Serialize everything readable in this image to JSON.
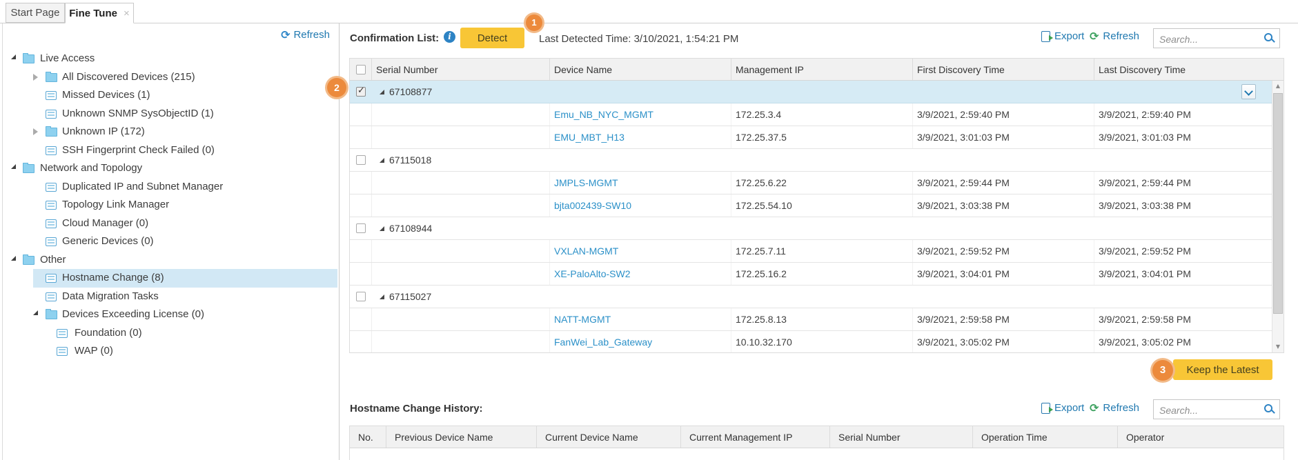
{
  "tabs": [
    {
      "label": "Start Page",
      "active": false
    },
    {
      "label": "Fine Tune",
      "active": true,
      "closable": true
    }
  ],
  "icons": {
    "close": "×",
    "refresh": "⟳",
    "scroll_up": "▲",
    "scroll_down": "▼",
    "info": "i",
    "check": "✓"
  },
  "left_panel": {
    "refresh_label": "Refresh",
    "tree": [
      {
        "label": "Live Access",
        "type": "folder",
        "level": 0,
        "expander": "expanded"
      },
      {
        "label": "All Discovered Devices (215)",
        "type": "folder",
        "level": 1,
        "expander": "collapsed"
      },
      {
        "label": "Missed Devices (1)",
        "type": "list",
        "level": 1,
        "expander": "none"
      },
      {
        "label": "Unknown SNMP SysObjectID (1)",
        "type": "list",
        "level": 1,
        "expander": "none"
      },
      {
        "label": "Unknown IP (172)",
        "type": "folder",
        "level": 1,
        "expander": "collapsed"
      },
      {
        "label": "SSH Fingerprint Check Failed (0)",
        "type": "list",
        "level": 1,
        "expander": "none"
      },
      {
        "label": "Network and Topology",
        "type": "folder",
        "level": 0,
        "expander": "expanded"
      },
      {
        "label": "Duplicated IP and Subnet Manager",
        "type": "list",
        "level": 1,
        "expander": "none"
      },
      {
        "label": "Topology Link Manager",
        "type": "list",
        "level": 1,
        "expander": "none"
      },
      {
        "label": "Cloud Manager (0)",
        "type": "list",
        "level": 1,
        "expander": "none"
      },
      {
        "label": "Generic Devices (0)",
        "type": "list",
        "level": 1,
        "expander": "none"
      },
      {
        "label": "Other",
        "type": "folder",
        "level": 0,
        "expander": "expanded"
      },
      {
        "label": "Hostname Change (8)",
        "type": "list",
        "level": 1,
        "expander": "none",
        "selected": true
      },
      {
        "label": "Data Migration Tasks",
        "type": "list",
        "level": 1,
        "expander": "none"
      },
      {
        "label": "Devices Exceeding License (0)",
        "type": "folder",
        "level": 1,
        "expander": "expanded"
      },
      {
        "label": "Foundation (0)",
        "type": "list",
        "level": 2,
        "expander": "none"
      },
      {
        "label": "WAP (0)",
        "type": "list",
        "level": 2,
        "expander": "none"
      }
    ]
  },
  "confirmation": {
    "title": "Confirmation List:",
    "detect_label": "Detect",
    "last_detected": "Last Detected Time: 3/10/2021, 1:54:21 PM",
    "export_label": "Export",
    "refresh_label": "Refresh",
    "search_placeholder": "Search...",
    "columns": [
      "Serial Number",
      "Device Name",
      "Management IP",
      "First Discovery Time",
      "Last Discovery Time"
    ],
    "groups": [
      {
        "serial": "67108877",
        "checked": true,
        "selected": true,
        "devices": [
          {
            "name": "Emu_NB_NYC_MGMT",
            "ip": "172.25.3.4",
            "first": "3/9/2021, 2:59:40 PM",
            "last": "3/9/2021, 2:59:40 PM"
          },
          {
            "name": "EMU_MBT_H13",
            "ip": "172.25.37.5",
            "first": "3/9/2021, 3:01:03 PM",
            "last": "3/9/2021, 3:01:03 PM"
          }
        ]
      },
      {
        "serial": "67115018",
        "checked": false,
        "selected": false,
        "devices": [
          {
            "name": "JMPLS-MGMT",
            "ip": "172.25.6.22",
            "first": "3/9/2021, 2:59:44 PM",
            "last": "3/9/2021, 2:59:44 PM"
          },
          {
            "name": "bjta002439-SW10",
            "ip": "172.25.54.10",
            "first": "3/9/2021, 3:03:38 PM",
            "last": "3/9/2021, 3:03:38 PM"
          }
        ]
      },
      {
        "serial": "67108944",
        "checked": false,
        "selected": false,
        "devices": [
          {
            "name": "VXLAN-MGMT",
            "ip": "172.25.7.11",
            "first": "3/9/2021, 2:59:52 PM",
            "last": "3/9/2021, 2:59:52 PM"
          },
          {
            "name": "XE-PaloAlto-SW2",
            "ip": "172.25.16.2",
            "first": "3/9/2021, 3:04:01 PM",
            "last": "3/9/2021, 3:04:01 PM"
          }
        ]
      },
      {
        "serial": "67115027",
        "checked": false,
        "selected": false,
        "devices": [
          {
            "name": "NATT-MGMT",
            "ip": "172.25.8.13",
            "first": "3/9/2021, 2:59:58 PM",
            "last": "3/9/2021, 2:59:58 PM"
          },
          {
            "name": "FanWei_Lab_Gateway",
            "ip": "10.10.32.170",
            "first": "3/9/2021, 3:05:02 PM",
            "last": "3/9/2021, 3:05:02 PM"
          }
        ]
      }
    ],
    "keep_latest_label": "Keep the Latest"
  },
  "history": {
    "title": "Hostname Change History:",
    "export_label": "Export",
    "refresh_label": "Refresh",
    "search_placeholder": "Search...",
    "columns": [
      "No.",
      "Previous Device Name",
      "Current Device Name",
      "Current Management IP",
      "Serial Number",
      "Operation Time",
      "Operator"
    ]
  },
  "badges": {
    "one": "1",
    "two": "2",
    "three": "3"
  },
  "colors": {
    "accent_yellow": "#f8c636",
    "badge_orange": "#ec8a3c",
    "link_blue": "#2079b0",
    "device_link_blue": "#2b90c8",
    "selection_blue": "#d6ebf5",
    "tree_selection_blue": "#d2e8f5"
  }
}
